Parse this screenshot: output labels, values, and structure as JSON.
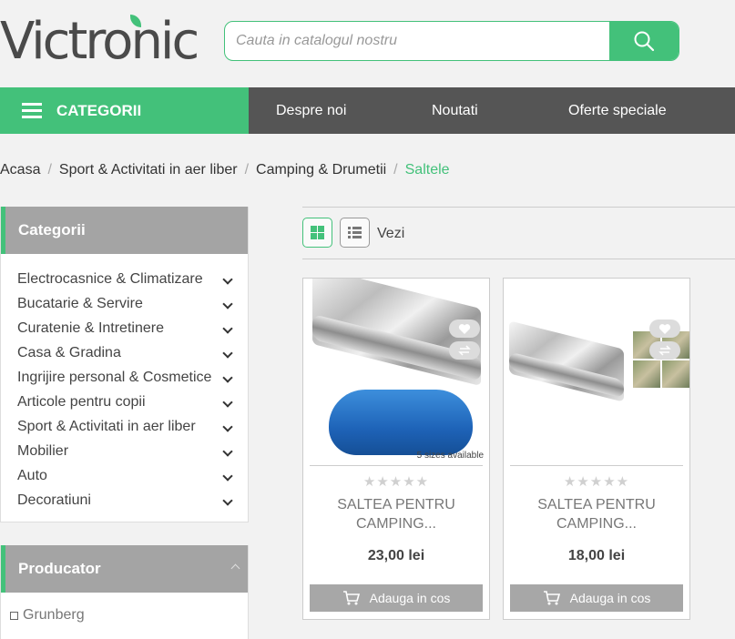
{
  "header": {
    "logo_text": "Victronic",
    "search_placeholder": "Cauta in catalogul nostru"
  },
  "nav": {
    "categories_label": "CATEGORII",
    "links": [
      "Despre noi",
      "Noutati",
      "Oferte speciale"
    ]
  },
  "breadcrumb": [
    "Acasa",
    "Sport & Activitati in aer liber",
    "Camping & Drumetii",
    "Saltele"
  ],
  "sidebar": {
    "categories_title": "Categorii",
    "categories": [
      "Electrocasnice & Climatizare",
      "Bucatarie & Servire",
      "Curatenie & Intretinere",
      "Casa & Gradina",
      "Ingrijire personal & Cosmetice",
      "Articole pentru copii",
      "Sport & Activitati in aer liber",
      "Mobilier",
      "Auto",
      "Decoratiuni"
    ],
    "producer_title": "Producator",
    "producers": [
      "Grunberg"
    ]
  },
  "toolbar": {
    "view_label": "Vezi"
  },
  "products": [
    {
      "name": "SALTEA PENTRU CAMPING...",
      "price": "23,00 lei",
      "badge": "5 sizes available",
      "cart_label": "Adauga in cos",
      "rating": 0
    },
    {
      "name": "SALTEA PENTRU CAMPING...",
      "price": "18,00 lei",
      "badge": "",
      "cart_label": "Adauga in cos",
      "rating": 0
    }
  ],
  "colors": {
    "accent": "#43c17a",
    "nav_bg": "#555555",
    "panel_head": "#a4a4a4"
  }
}
